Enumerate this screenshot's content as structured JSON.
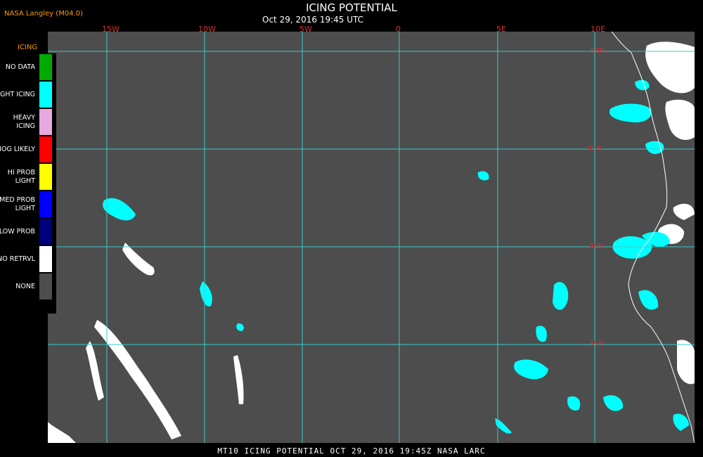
{
  "header": {
    "source": "NASA Langley (M04.0)",
    "title": "ICING POTENTIAL",
    "subtitle": "Oct 29, 2016 19:45 UTC"
  },
  "map": {
    "longitude_labels": [
      "15W",
      "10W",
      "5W",
      "0",
      "5E",
      "10E"
    ],
    "latitude_labels": [
      "50N",
      "45N",
      "40N",
      "35N"
    ],
    "colors": {
      "background": "#4d4d4d",
      "grid": "#33cccc",
      "coastline": "#ffffff",
      "icing": "#00ffff",
      "no_retrieval": "#ffffff"
    }
  },
  "legend": {
    "title": "ICING",
    "items": [
      {
        "label": "NO DATA",
        "color": "#00aa00"
      },
      {
        "label": "NIGHT ICING",
        "color": "#00ffff"
      },
      {
        "label": "HEAVY ICING",
        "color": "#e8a8e0"
      },
      {
        "label": "MOG LIKELY",
        "color": "#ff0000"
      },
      {
        "label": "HI PROB LIGHT",
        "color": "#ffff00"
      },
      {
        "label": "MED PROB LIGHT",
        "color": "#0000ff"
      },
      {
        "label": "LOW PROB",
        "color": "#00007a"
      },
      {
        "label": "NO RETRVL",
        "color": "#ffffff"
      },
      {
        "label": "NONE",
        "color": "#4d4d4d"
      }
    ]
  },
  "footer": {
    "text": "MT10  ICING POTENTIAL  OCT 29, 2016 19:45Z  NASA LARC"
  }
}
